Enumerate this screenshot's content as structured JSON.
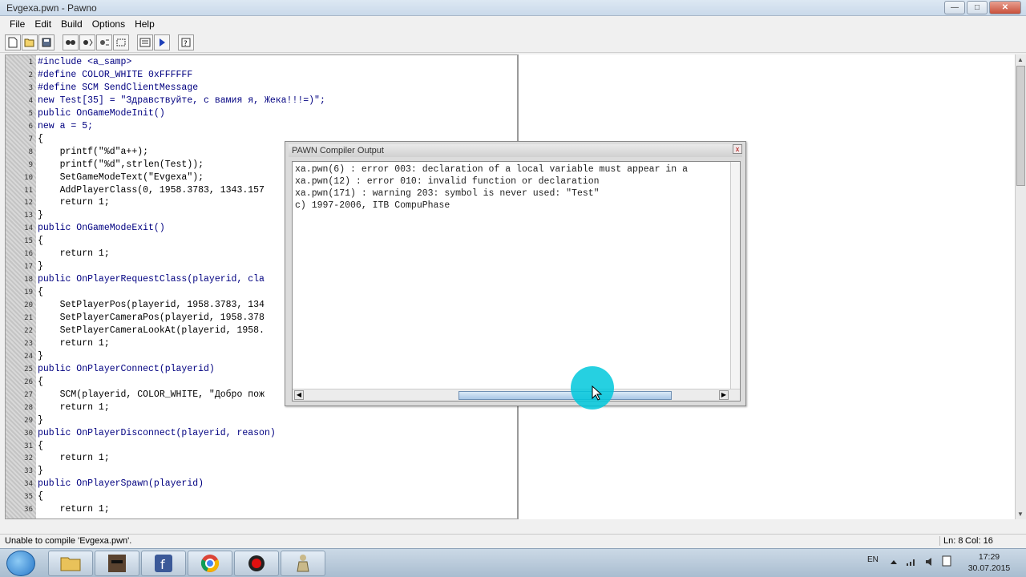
{
  "window": {
    "title": "Evgexa.pwn - Pawno",
    "buttons": {
      "minimize": "—",
      "maximize": "□",
      "close": "✕"
    }
  },
  "menu": [
    "File",
    "Edit",
    "Build",
    "Options",
    "Help"
  ],
  "toolbar": {
    "icons": [
      "new-file-icon",
      "open-folder-icon",
      "save-icon",
      "find-icon",
      "find-next-icon",
      "replace-icon",
      "goto-icon",
      "function-list-icon",
      "compile-run-icon",
      "help-icon"
    ]
  },
  "editor": {
    "lines": [
      {
        "n": "1",
        "text": "#include <a_samp>"
      },
      {
        "n": "2",
        "text": "#define COLOR_WHITE 0xFFFFFF"
      },
      {
        "n": "3",
        "text": "#define SCM SendClientMessage"
      },
      {
        "n": "4",
        "text": "new Test[35] = \"Здравствуйте, с вамия я, Жека!!!=)\";"
      },
      {
        "n": "5",
        "text": "public OnGameModeInit()"
      },
      {
        "n": "6",
        "text": "new a = 5;"
      },
      {
        "n": "7",
        "text": "{"
      },
      {
        "n": "8",
        "text": "    printf(\"%d\"a++);"
      },
      {
        "n": "9",
        "text": "    printf(\"%d\",strlen(Test));"
      },
      {
        "n": "10",
        "text": "    SetGameModeText(\"Evgexa\");"
      },
      {
        "n": "11",
        "text": "    AddPlayerClass(0, 1958.3783, 1343.157"
      },
      {
        "n": "12",
        "text": "    return 1;"
      },
      {
        "n": "13",
        "text": "}"
      },
      {
        "n": "14",
        "text": "public OnGameModeExit()"
      },
      {
        "n": "15",
        "text": "{"
      },
      {
        "n": "16",
        "text": "    return 1;"
      },
      {
        "n": "17",
        "text": "}"
      },
      {
        "n": "18",
        "text": "public OnPlayerRequestClass(playerid, cla"
      },
      {
        "n": "19",
        "text": "{"
      },
      {
        "n": "20",
        "text": "    SetPlayerPos(playerid, 1958.3783, 134"
      },
      {
        "n": "21",
        "text": "    SetPlayerCameraPos(playerid, 1958.378"
      },
      {
        "n": "22",
        "text": "    SetPlayerCameraLookAt(playerid, 1958."
      },
      {
        "n": "23",
        "text": "    return 1;"
      },
      {
        "n": "24",
        "text": "}"
      },
      {
        "n": "25",
        "text": "public OnPlayerConnect(playerid)"
      },
      {
        "n": "26",
        "text": "{"
      },
      {
        "n": "27",
        "text": "    SCM(playerid, COLOR_WHITE, \"Добро пож"
      },
      {
        "n": "28",
        "text": "    return 1;"
      },
      {
        "n": "29",
        "text": "}"
      },
      {
        "n": "30",
        "text": "public OnPlayerDisconnect(playerid, reason)"
      },
      {
        "n": "31",
        "text": "{"
      },
      {
        "n": "32",
        "text": "    return 1;"
      },
      {
        "n": "33",
        "text": "}"
      },
      {
        "n": "34",
        "text": "public OnPlayerSpawn(playerid)"
      },
      {
        "n": "35",
        "text": "{"
      },
      {
        "n": "36",
        "text": "    return 1;"
      }
    ]
  },
  "compiler_dialog": {
    "title": "PAWN Compiler Output",
    "close": "x",
    "lines": [
      "xa.pwn(6) : error 003: declaration of a local variable must appear in a",
      "xa.pwn(12) : error 010: invalid function or declaration",
      "xa.pwn(171) : warning 203: symbol is never used: \"Test\"",
      "c) 1997-2006, ITB CompuPhase"
    ]
  },
  "statusbar": {
    "message": "Unable to compile 'Evgexa.pwn'.",
    "line": "Ln: 8",
    "col": "Col: 16"
  },
  "taskbar": {
    "apps": [
      "file-explorer-icon",
      "game-avatar-icon",
      "facebook-icon",
      "chrome-icon",
      "record-icon",
      "pawno-icon"
    ],
    "tray": {
      "lang": "EN"
    },
    "clock": {
      "time": "17:29",
      "date": "30.07.2015"
    }
  }
}
